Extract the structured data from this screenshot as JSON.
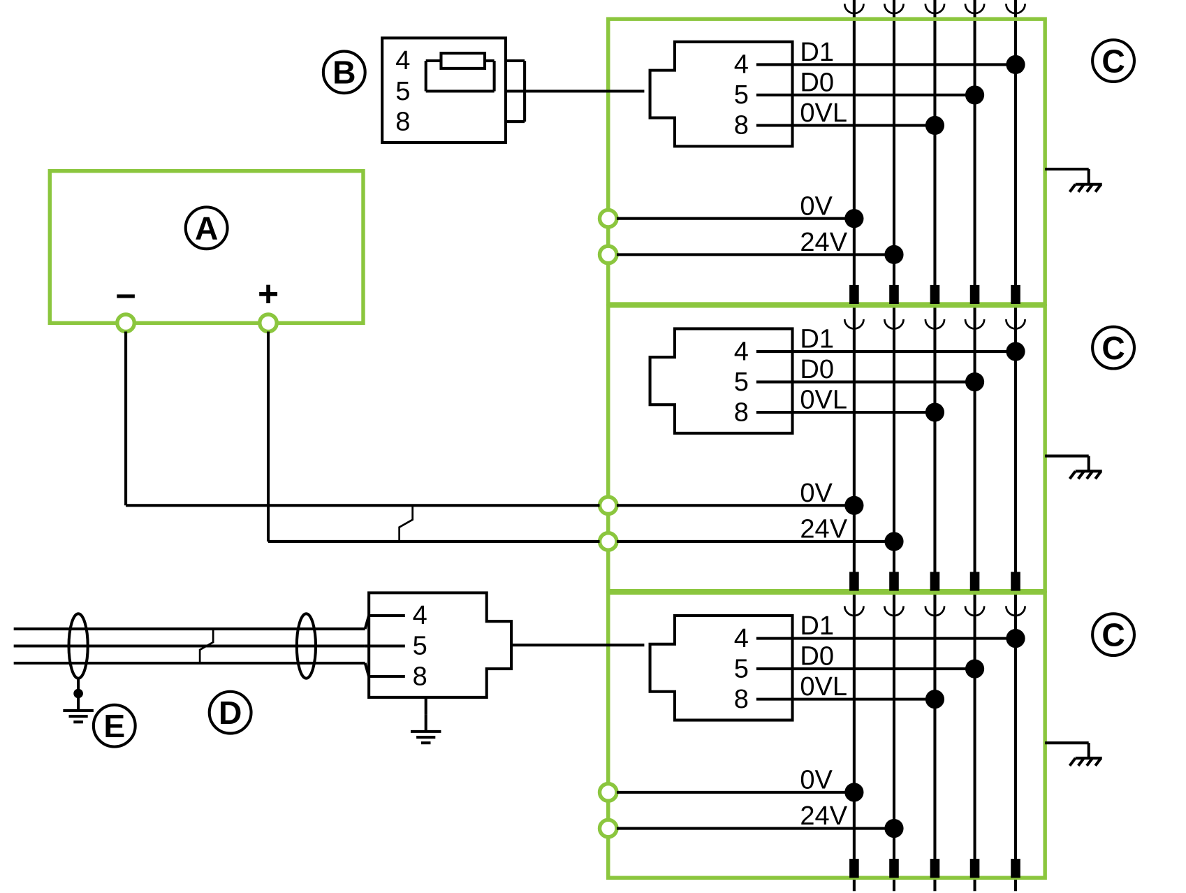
{
  "labels": {
    "A": "A",
    "B": "B",
    "C": "C",
    "D": "D",
    "E": "E"
  },
  "supply": {
    "minus": "–",
    "plus": "+"
  },
  "terminator": {
    "pins": [
      "4",
      "5",
      "8"
    ]
  },
  "bottom_plug": {
    "pins": [
      "4",
      "5",
      "8"
    ]
  },
  "module": {
    "pins": [
      "4",
      "5",
      "8"
    ],
    "signals": [
      "D1",
      "D0",
      "0VL"
    ],
    "pwr": [
      "0V",
      "24V"
    ]
  },
  "bus_x": {
    "v1": 895,
    "v2": 937,
    "v3": 980,
    "v4": 1022,
    "v5": 1065
  },
  "module_y": [
    20,
    322,
    624
  ],
  "module_h": 300,
  "col": {
    "boxL": 636,
    "boxR": 1096,
    "jackL": 680,
    "jackR": 830,
    "sigX": 838
  }
}
